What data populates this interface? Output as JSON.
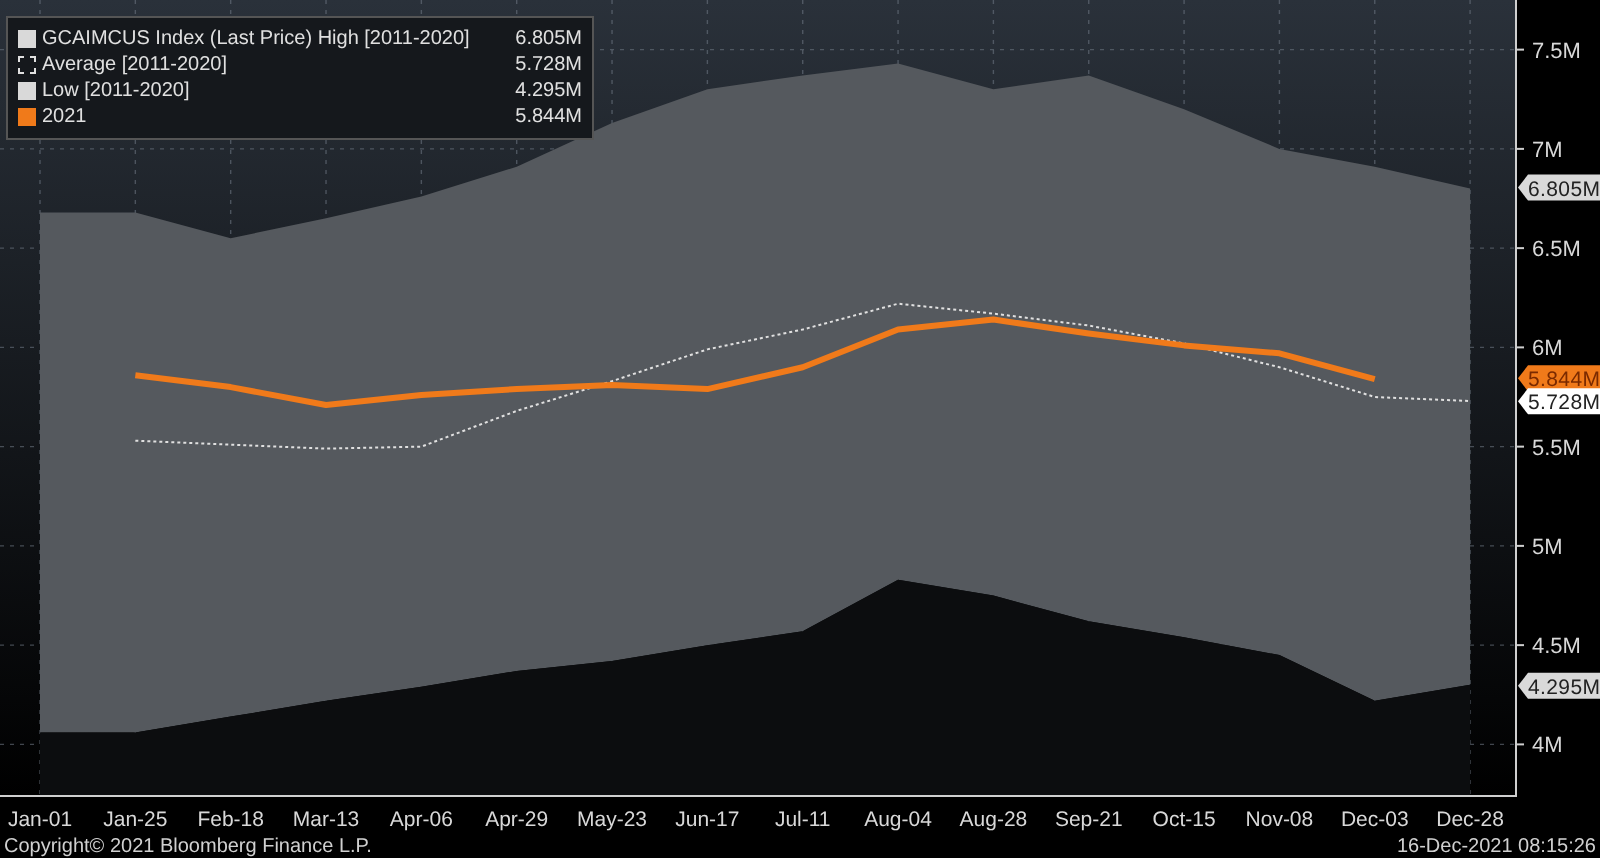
{
  "chart": {
    "chart_data": {
      "type": "line",
      "grid": true,
      "categories": [
        "Jan-01",
        "Jan-25",
        "Feb-18",
        "Mar-13",
        "Apr-06",
        "Apr-29",
        "May-23",
        "Jun-17",
        "Jul-11",
        "Aug-04",
        "Aug-28",
        "Sep-21",
        "Oct-15",
        "Nov-08",
        "Dec-03",
        "Dec-28"
      ],
      "ylim": [
        3.74,
        7.75
      ],
      "yticks": [
        {
          "value": 4,
          "label": "4M"
        },
        {
          "value": 4.5,
          "label": "4.5M"
        },
        {
          "value": 5,
          "label": "5M"
        },
        {
          "value": 5.5,
          "label": "5.5M"
        },
        {
          "value": 6,
          "label": "6M"
        },
        {
          "value": 6.5,
          "label": "6.5M"
        },
        {
          "value": 7,
          "label": "7M"
        },
        {
          "value": 7.5,
          "label": "7.5M"
        }
      ],
      "series": [
        {
          "name": "GCAIMCUS Index (Last Price) High [2011-2020]",
          "color": "#55595e",
          "type": "area",
          "values": [
            6.68,
            6.68,
            6.55,
            6.65,
            6.76,
            6.91,
            7.13,
            7.3,
            7.37,
            7.43,
            7.3,
            7.37,
            7.2,
            7.0,
            6.91,
            6.8
          ]
        },
        {
          "name": "Average  [2011-2020]",
          "color": "#e0e0e0",
          "line_style": "dotted",
          "values": [
            null,
            5.53,
            5.51,
            5.49,
            5.5,
            5.68,
            5.83,
            5.99,
            6.09,
            6.22,
            6.17,
            6.11,
            6.02,
            5.9,
            5.75,
            5.73
          ]
        },
        {
          "name": "Low  [2011-2020]",
          "color": "#0c0d0f",
          "type": "area",
          "values": [
            4.06,
            4.06,
            4.14,
            4.22,
            4.29,
            4.37,
            4.42,
            4.5,
            4.57,
            4.83,
            4.75,
            4.62,
            4.54,
            4.45,
            4.22,
            4.3
          ]
        },
        {
          "name": "2021",
          "color": "#f07a1a",
          "line_style": "solid",
          "values": [
            null,
            5.86,
            5.8,
            5.71,
            5.76,
            5.79,
            5.81,
            5.79,
            5.9,
            6.09,
            6.14,
            6.07,
            6.01,
            5.97,
            5.84,
            null
          ]
        }
      ]
    },
    "legend": [
      {
        "kind": "band-high",
        "value": "6.805M",
        "color": "#d9d9d9"
      },
      {
        "kind": "average",
        "value": "5.728M",
        "color": "#e0e0e0"
      },
      {
        "kind": "band-low",
        "value": "4.295M",
        "color": "#d9d9d9"
      },
      {
        "kind": "line",
        "value": "5.844M",
        "color": "#f07a1a"
      }
    ],
    "axis_tags": [
      {
        "text": "6.805M",
        "color": "#d9d9d9"
      },
      {
        "text": "5.844M",
        "color": "#f07a1a"
      },
      {
        "text": "5.728M",
        "color": "#ffffff"
      },
      {
        "text": "4.295M",
        "color": "#d9d9d9"
      }
    ]
  },
  "footer": {
    "copyright": "Copyright© 2021 Bloomberg Finance L.P.",
    "timestamp": "16-Dec-2021 08:15:26"
  }
}
